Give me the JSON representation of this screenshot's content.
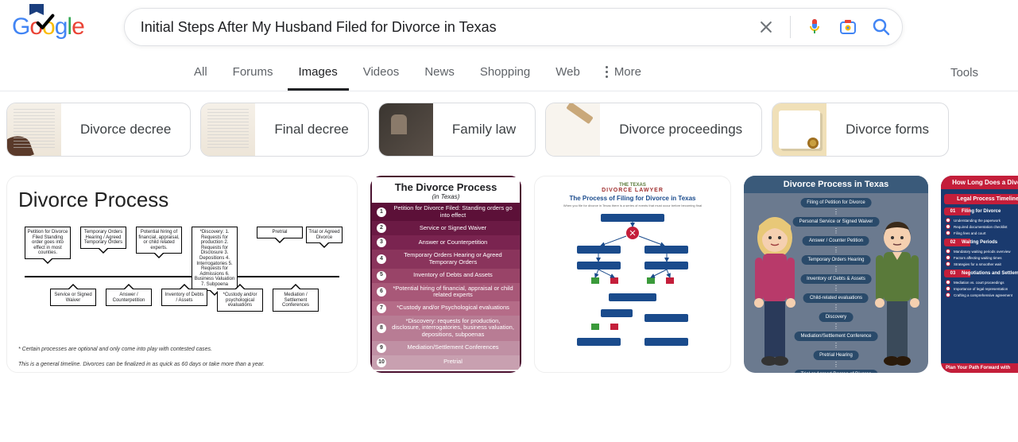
{
  "logo": {
    "text": "Google"
  },
  "search": {
    "query": "Initial Steps After My Husband Filed for Divorce in Texas"
  },
  "tabs": {
    "items": [
      "All",
      "Forums",
      "Images",
      "Videos",
      "News",
      "Shopping",
      "Web"
    ],
    "active_index": 2,
    "more": "More",
    "tools": "Tools"
  },
  "chips": [
    {
      "label": "Divorce decree"
    },
    {
      "label": "Final decree"
    },
    {
      "label": "Family law"
    },
    {
      "label": "Divorce proceedings"
    },
    {
      "label": "Divorce forms"
    }
  ],
  "results": {
    "card1": {
      "title": "Divorce Process",
      "top_nodes": [
        "Petition for Divorce Filed Standing order goes into effect in most counties.",
        "Temporary Orders Hearing / Agreed Temporary Orders",
        "Potential hiring of financial, appraisal, or child related experts.",
        "*Discovery: 1. Requests for production 2. Requests for Disclosure 3. Depositions 4. Interrogatories 5. Requests for Admissions 6. Business Valuation 7. Subpoena",
        "Pretrial",
        "Trial or Agreed Divorce"
      ],
      "bot_nodes": [
        "Service or Signed Waiver",
        "Answer / Counterpetition",
        "Inventory of Debts / Assets",
        "*Custody and/or psychological evaluations",
        "Mediation / Settlement Conferences"
      ],
      "footnote1": "* Certain processes are optional and only come into play with contested cases.",
      "footnote2": "This is a general timeline. Divorces can be finalized in as quick as 60 days or take more than a year."
    },
    "card2": {
      "title": "The Divorce Process",
      "subtitle": "(in Texas)",
      "steps": [
        {
          "n": "1",
          "bg": "#5c1038",
          "t": "Petition for Divorce Filed: Standing orders go into effect"
        },
        {
          "n": "2",
          "bg": "#6b1a44",
          "t": "Service or Signed Waiver"
        },
        {
          "n": "3",
          "bg": "#7a2450",
          "t": "Answer or Counterpetition"
        },
        {
          "n": "4",
          "bg": "#8a345c",
          "t": "Temporary Orders Hearing or Agreed Temporary Orders"
        },
        {
          "n": "5",
          "bg": "#994468",
          "t": "Inventory of Debts and Assets"
        },
        {
          "n": "6",
          "bg": "#a85878",
          "t": "*Potential hiring of financial, appraisal or child related experts"
        },
        {
          "n": "7",
          "bg": "#b56c88",
          "t": "*Custody and/or Psychological evaluations"
        },
        {
          "n": "8",
          "bg": "#b87c94",
          "t": "*Discovery: requests for production, disclosure, interrogatories, business valuation, depositions, subpoenas"
        },
        {
          "n": "9",
          "bg": "#c090a4",
          "t": "Mediation/Settlement Conferences"
        },
        {
          "n": "10",
          "bg": "#c8a0b0",
          "t": "Pretrial"
        }
      ]
    },
    "card3": {
      "brand": "THE TEXAS",
      "brand2": "DIVORCE LAWYER",
      "title": "The Process of Filing for Divorce in Texas"
    },
    "card4": {
      "title": "Divorce Process in Texas",
      "pills": [
        "Filing of Petition for Divorce",
        "Personal Service or Signed Waiver",
        "Answer / Counter Petition",
        "Temporary Orders Hearing",
        "Inventory of Debts & Assets",
        "Child-related evaluations",
        "Discovery",
        "Mediation/Settlement Conference",
        "Pretrial Hearing",
        "Trial or Agreed Decree of Divorce"
      ]
    },
    "card5": {
      "top": "How Long Does a Divor",
      "sub": "Legal Process Timeline",
      "sections": [
        {
          "n": "01",
          "t": "Filing for Divorce",
          "items": [
            "Understanding the paperwork",
            "Required documentation checklist",
            "Filing fees and court"
          ]
        },
        {
          "n": "02",
          "t": "Waiting Periods",
          "items": [
            "Mandatory waiting periods overview",
            "Factors affecting waiting times",
            "Strategies for a smoother wait"
          ]
        },
        {
          "n": "03",
          "t": "Negotiations and Settlement",
          "items": [
            "Mediation vs. court proceedings",
            "Importance of legal representation",
            "Crafting a comprehensive agreement"
          ]
        }
      ],
      "bottom": "Plan Your Path Forward with"
    }
  }
}
